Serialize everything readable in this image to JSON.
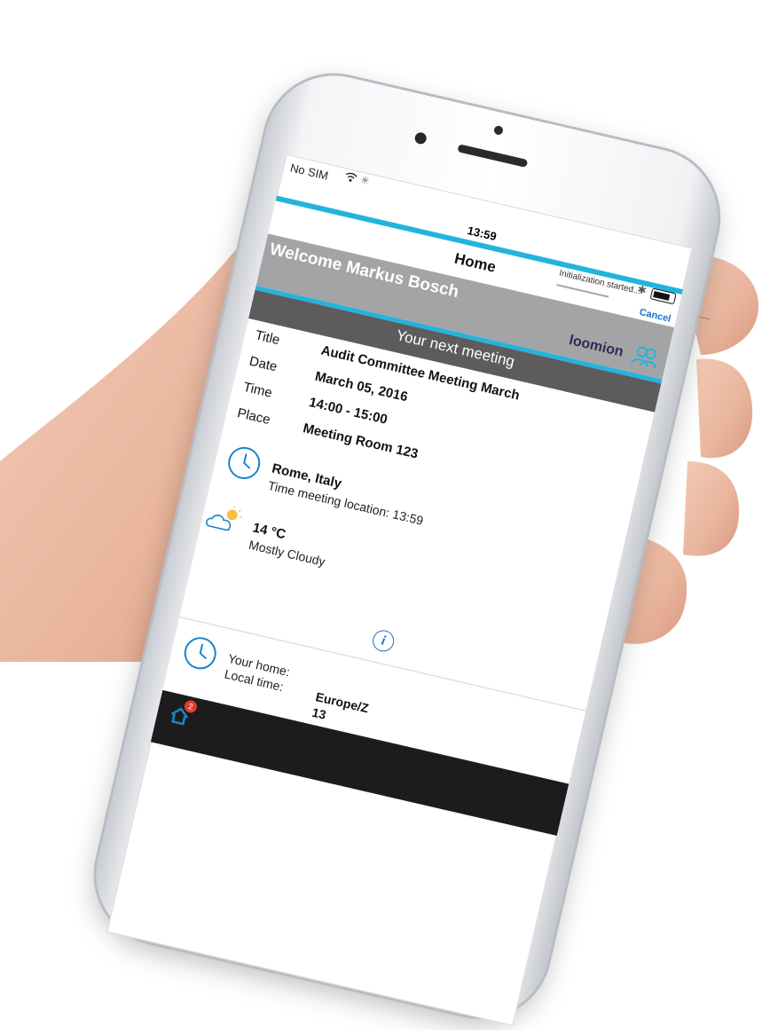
{
  "status": {
    "carrier": "No SIM",
    "time": "13:59",
    "init_text": "Initialization started...",
    "cancel": "Cancel"
  },
  "nav": {
    "title": "Home"
  },
  "welcome": {
    "text": "Welcome Markus Bosch",
    "logo": "loomion"
  },
  "next_meeting": {
    "header": "Your next meeting",
    "rows": [
      {
        "label": "Title",
        "value": "Audit Committee Meeting March"
      },
      {
        "label": "Date",
        "value": "March 05, 2016"
      },
      {
        "label": "Time",
        "value": "14:00 - 15:00"
      },
      {
        "label": "Place",
        "value": "Meeting Room 123"
      }
    ]
  },
  "location": {
    "city": "Rome, Italy",
    "time_line": "Time meeting location: 13:59"
  },
  "weather": {
    "temp": "14 °C",
    "desc": "Mostly Cloudy"
  },
  "home": {
    "your_home_label": "Your home:",
    "local_time_label": "Local time:",
    "timezone": "Europe/Z",
    "local_time_partial": "13"
  },
  "tabbar": {
    "badge": "2"
  },
  "icons": {
    "wifi": "wifi-icon",
    "bluetooth": "bluetooth-icon",
    "battery": "battery-icon",
    "chevron": "chevron-right-icon",
    "clock": "clock-icon",
    "weather": "partly-cloudy-icon",
    "info": "info-icon"
  },
  "colors": {
    "accent": "#22b4dc",
    "welcome_bg": "#a3a4a5",
    "band_bg": "#5c5c5c",
    "link": "#1a73c9"
  }
}
